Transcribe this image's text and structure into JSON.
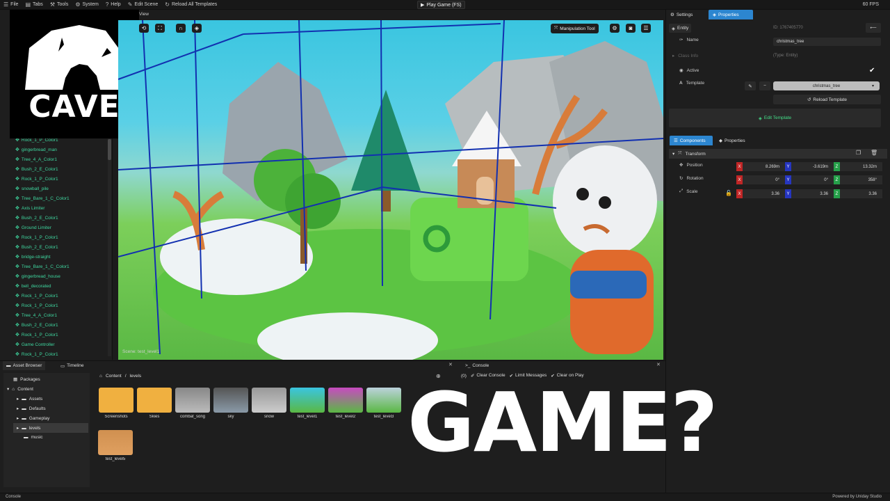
{
  "menubar": {
    "items": [
      {
        "label": "File",
        "icon": "hamburger-icon"
      },
      {
        "label": "Tabs",
        "icon": "tabs-icon"
      },
      {
        "label": "Tools",
        "icon": "tools-icon"
      },
      {
        "label": "System",
        "icon": "system-icon"
      },
      {
        "label": "Help",
        "icon": "help-icon"
      },
      {
        "label": "Edit Scene",
        "icon": "edit-icon"
      },
      {
        "label": "Reload All Templates",
        "icon": "reload-icon"
      }
    ],
    "play_label": "Play Game (FS)",
    "fps": "60 FPS"
  },
  "logo": {
    "text": "CAVE"
  },
  "hierarchy": {
    "items": [
      "Rock_1_P_Color1",
      "gingerbread_man",
      "Tree_4_A_Color1",
      "Bush_2_E_Color1",
      "Rock_1_P_Color1",
      "snowball_pile",
      "Tree_Bare_1_C_Color1",
      "Axis Limiter",
      "Bush_2_E_Color1",
      "Ground Limiter",
      "Rock_1_P_Color1",
      "Bush_2_E_Color1",
      "bridge-straight",
      "Tree_Bare_1_C_Color1",
      "gingerbread_house",
      "bell_decorated",
      "Rock_1_P_Color1",
      "Rock_1_P_Color1",
      "Tree_4_A_Color1",
      "Bush_2_E_Color1",
      "Rock_1_P_Color1",
      "Game Controller",
      "Rock_1_P_Color1"
    ]
  },
  "viewport": {
    "tab_label": "View",
    "manipulation_label": "Manipulation Tool",
    "scene_label": "Scene: test_level1"
  },
  "right_panel": {
    "tabs": [
      "Settings",
      "Properties"
    ],
    "entity_label": "Entity",
    "entity_id": "ID: 1767405770",
    "name_label": "Name",
    "name_value": "christmas_tree",
    "class_info_label": "Class Info",
    "class_info_value": "(Type: Entity)",
    "active_label": "Active",
    "template_label": "Template",
    "template_value": "christmas_tree",
    "reload_template": "Reload Template",
    "edit_template": "Edit Template",
    "sub_tabs": [
      "Components",
      "Properties"
    ],
    "transform_label": "Transform",
    "position_label": "Position",
    "rotation_label": "Rotation",
    "scale_label": "Scale",
    "position": [
      "8.269m",
      "-3.619m",
      "13.32m"
    ],
    "rotation": [
      "0°",
      "0°",
      "358°"
    ],
    "scale": [
      "3.36",
      "3.36",
      "3.36"
    ],
    "axis_colors": {
      "x": "#c02626",
      "y": "#2636c0",
      "z": "#26a04a"
    }
  },
  "bottom": {
    "tabs": [
      "Asset Browser",
      "Timeline"
    ],
    "console_tab": "Console",
    "tree": {
      "packages": "Packages",
      "content": "Content",
      "children": [
        "Assets",
        "Defaults",
        "Gameplay",
        "levels",
        "music"
      ]
    },
    "breadcrumb": {
      "root": "Content",
      "sep": "/",
      "current": "levels"
    },
    "assets": [
      {
        "name": "Screenshots",
        "kind": "folder"
      },
      {
        "name": "Skies",
        "kind": "folder"
      },
      {
        "name": "combat_song",
        "kind": "audio"
      },
      {
        "name": "sky",
        "kind": "sky"
      },
      {
        "name": "snow",
        "kind": "audio"
      },
      {
        "name": "test_level1",
        "kind": "level"
      },
      {
        "name": "test_level2",
        "kind": "level"
      },
      {
        "name": "test_level3",
        "kind": "level"
      },
      {
        "name": "test_level5",
        "kind": "level"
      }
    ],
    "console": {
      "count": "(0)",
      "clear": "Clear Console",
      "limit": "Limit Messages",
      "clear_on_play": "Clear on Play"
    }
  },
  "status": {
    "left": "Console",
    "right": "Powered by Uniday Studio"
  },
  "overlay_text": "GAME?"
}
